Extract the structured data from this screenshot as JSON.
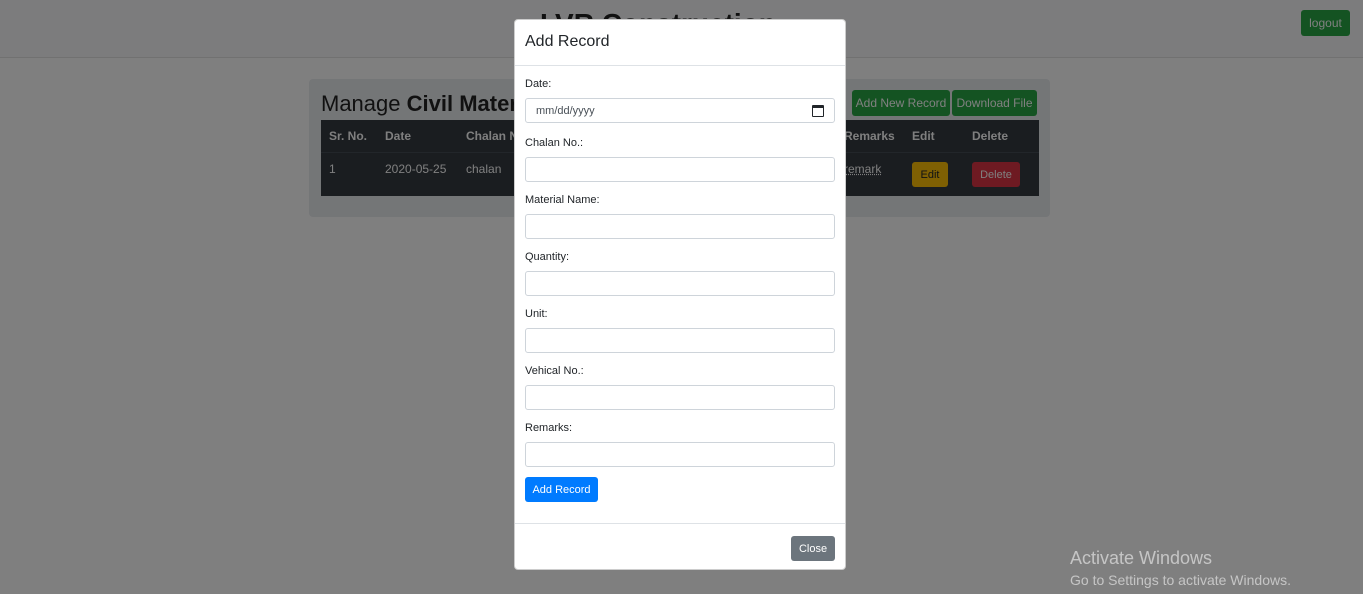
{
  "navbar": {
    "brand": "LVR Construction",
    "logout_label": "logout"
  },
  "panel": {
    "title_prefix": "Manage ",
    "title_bold": "Civil Material",
    "add_new_label": "Add New Record",
    "download_label": "Download File"
  },
  "table": {
    "headers": {
      "sr_no": "Sr. No.",
      "date": "Date",
      "chalan_no": "Chalan No.",
      "remarks": "Remarks",
      "edit": "Edit",
      "delete": "Delete"
    },
    "rows": [
      {
        "sr_no": "1",
        "date": "2020-05-25",
        "chalan_no": "chalan",
        "remarks": "remark",
        "edit_label": "Edit",
        "delete_label": "Delete"
      }
    ]
  },
  "modal": {
    "title": "Add Record",
    "fields": {
      "date_label": "Date:",
      "date_placeholder": "mm/dd/yyyy",
      "chalan_label": "Chalan No.:",
      "material_label": "Material Name:",
      "quantity_label": "Quantity:",
      "unit_label": "Unit:",
      "vehical_label": "Vehical No.:",
      "remarks_label": "Remarks:"
    },
    "submit_label": "Add Record",
    "close_label": "Close"
  },
  "watermark": {
    "title": "Activate Windows",
    "subtitle": "Go to Settings to activate Windows."
  }
}
